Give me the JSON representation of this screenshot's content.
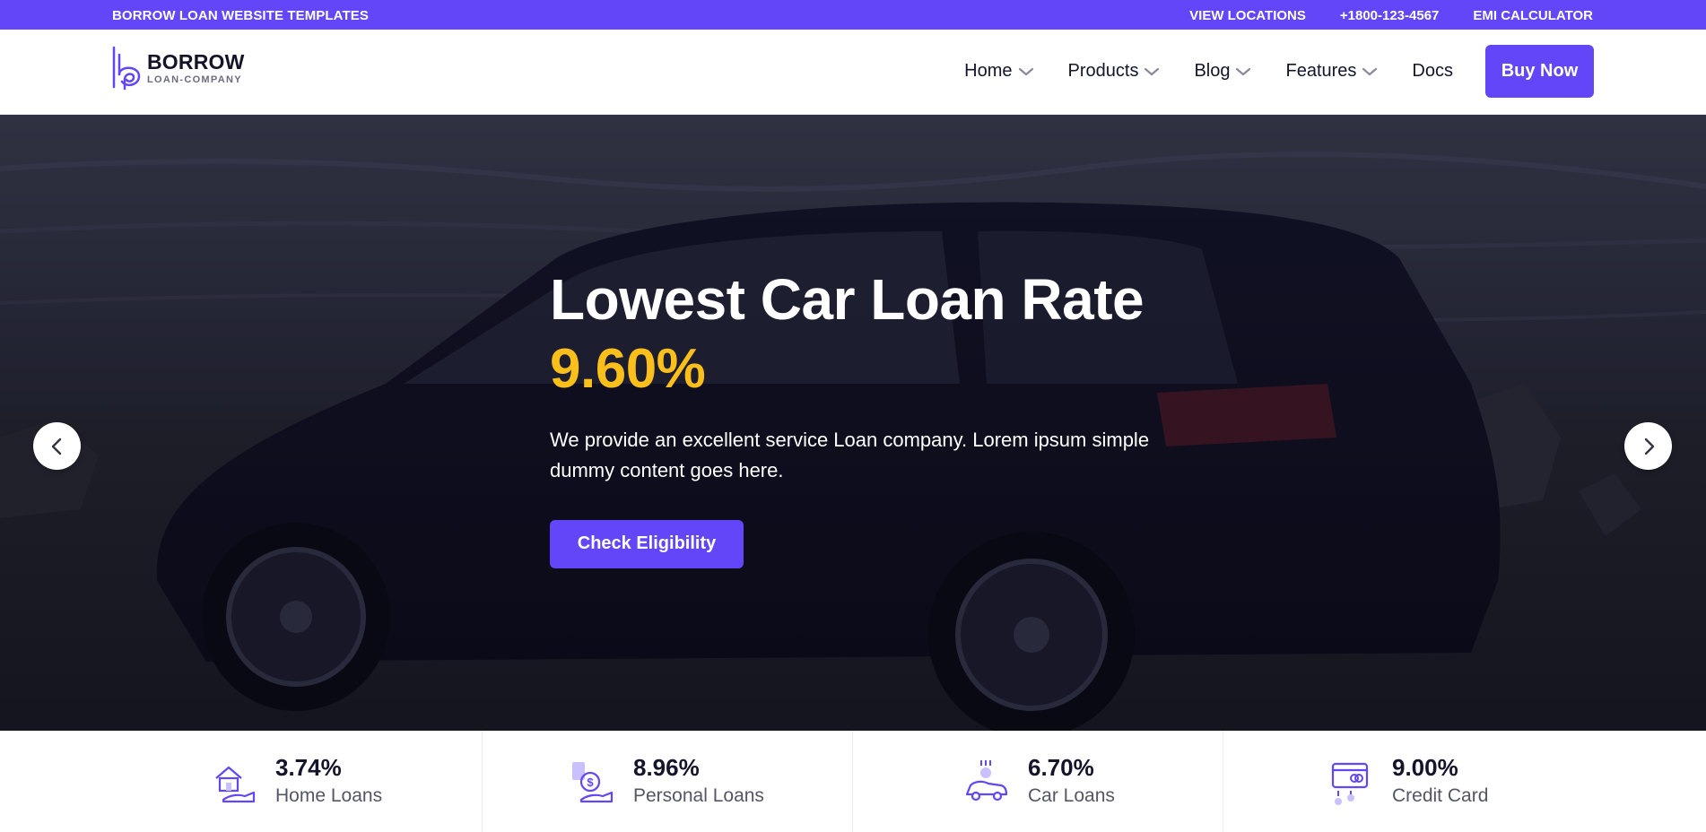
{
  "topbar": {
    "note": "BORROW LOAN WEBSITE TEMPLATES",
    "links": [
      "VIEW LOCATIONS",
      "+1800-123-4567",
      "EMI CALCULATOR"
    ]
  },
  "logo": {
    "name": "BORROW",
    "subtitle": "LOAN-COMPANY"
  },
  "nav": {
    "items": [
      {
        "label": "Home",
        "dropdown": true
      },
      {
        "label": "Products",
        "dropdown": true
      },
      {
        "label": "Blog",
        "dropdown": true
      },
      {
        "label": "Features",
        "dropdown": true
      },
      {
        "label": "Docs",
        "dropdown": false
      }
    ],
    "cta_label": "Buy Now"
  },
  "hero": {
    "title": "Lowest Car Loan Rate",
    "rate": "9.60%",
    "description": "We provide an excellent service Loan company. Lorem ipsum simple dummy content goes here.",
    "button_label": "Check Eligibility",
    "prev_icon": "chevron-left-icon",
    "next_icon": "chevron-right-icon"
  },
  "rates": [
    {
      "value": "3.74%",
      "label": "Home Loans",
      "icon": "home-loan-icon"
    },
    {
      "value": "8.96%",
      "label": "Personal Loans",
      "icon": "personal-loan-icon"
    },
    {
      "value": "6.70%",
      "label": "Car Loans",
      "icon": "car-loan-icon"
    },
    {
      "value": "9.00%",
      "label": "Credit Card",
      "icon": "credit-card-icon"
    }
  ],
  "colors": {
    "brand": "#6246f7",
    "accent_yellow": "#fbbf1b",
    "text_dark": "#14142b"
  }
}
